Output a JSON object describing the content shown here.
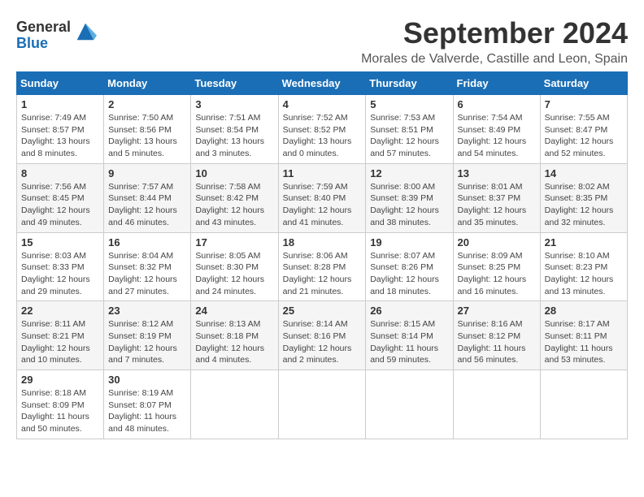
{
  "logo": {
    "general": "General",
    "blue": "Blue"
  },
  "title": "September 2024",
  "location": "Morales de Valverde, Castille and Leon, Spain",
  "days_of_week": [
    "Sunday",
    "Monday",
    "Tuesday",
    "Wednesday",
    "Thursday",
    "Friday",
    "Saturday"
  ],
  "weeks": [
    [
      {
        "day": "1",
        "sunrise": "7:49 AM",
        "sunset": "8:57 PM",
        "daylight": "13 hours and 8 minutes."
      },
      {
        "day": "2",
        "sunrise": "7:50 AM",
        "sunset": "8:56 PM",
        "daylight": "13 hours and 5 minutes."
      },
      {
        "day": "3",
        "sunrise": "7:51 AM",
        "sunset": "8:54 PM",
        "daylight": "13 hours and 3 minutes."
      },
      {
        "day": "4",
        "sunrise": "7:52 AM",
        "sunset": "8:52 PM",
        "daylight": "13 hours and 0 minutes."
      },
      {
        "day": "5",
        "sunrise": "7:53 AM",
        "sunset": "8:51 PM",
        "daylight": "12 hours and 57 minutes."
      },
      {
        "day": "6",
        "sunrise": "7:54 AM",
        "sunset": "8:49 PM",
        "daylight": "12 hours and 54 minutes."
      },
      {
        "day": "7",
        "sunrise": "7:55 AM",
        "sunset": "8:47 PM",
        "daylight": "12 hours and 52 minutes."
      }
    ],
    [
      {
        "day": "8",
        "sunrise": "7:56 AM",
        "sunset": "8:45 PM",
        "daylight": "12 hours and 49 minutes."
      },
      {
        "day": "9",
        "sunrise": "7:57 AM",
        "sunset": "8:44 PM",
        "daylight": "12 hours and 46 minutes."
      },
      {
        "day": "10",
        "sunrise": "7:58 AM",
        "sunset": "8:42 PM",
        "daylight": "12 hours and 43 minutes."
      },
      {
        "day": "11",
        "sunrise": "7:59 AM",
        "sunset": "8:40 PM",
        "daylight": "12 hours and 41 minutes."
      },
      {
        "day": "12",
        "sunrise": "8:00 AM",
        "sunset": "8:39 PM",
        "daylight": "12 hours and 38 minutes."
      },
      {
        "day": "13",
        "sunrise": "8:01 AM",
        "sunset": "8:37 PM",
        "daylight": "12 hours and 35 minutes."
      },
      {
        "day": "14",
        "sunrise": "8:02 AM",
        "sunset": "8:35 PM",
        "daylight": "12 hours and 32 minutes."
      }
    ],
    [
      {
        "day": "15",
        "sunrise": "8:03 AM",
        "sunset": "8:33 PM",
        "daylight": "12 hours and 29 minutes."
      },
      {
        "day": "16",
        "sunrise": "8:04 AM",
        "sunset": "8:32 PM",
        "daylight": "12 hours and 27 minutes."
      },
      {
        "day": "17",
        "sunrise": "8:05 AM",
        "sunset": "8:30 PM",
        "daylight": "12 hours and 24 minutes."
      },
      {
        "day": "18",
        "sunrise": "8:06 AM",
        "sunset": "8:28 PM",
        "daylight": "12 hours and 21 minutes."
      },
      {
        "day": "19",
        "sunrise": "8:07 AM",
        "sunset": "8:26 PM",
        "daylight": "12 hours and 18 minutes."
      },
      {
        "day": "20",
        "sunrise": "8:09 AM",
        "sunset": "8:25 PM",
        "daylight": "12 hours and 16 minutes."
      },
      {
        "day": "21",
        "sunrise": "8:10 AM",
        "sunset": "8:23 PM",
        "daylight": "12 hours and 13 minutes."
      }
    ],
    [
      {
        "day": "22",
        "sunrise": "8:11 AM",
        "sunset": "8:21 PM",
        "daylight": "12 hours and 10 minutes."
      },
      {
        "day": "23",
        "sunrise": "8:12 AM",
        "sunset": "8:19 PM",
        "daylight": "12 hours and 7 minutes."
      },
      {
        "day": "24",
        "sunrise": "8:13 AM",
        "sunset": "8:18 PM",
        "daylight": "12 hours and 4 minutes."
      },
      {
        "day": "25",
        "sunrise": "8:14 AM",
        "sunset": "8:16 PM",
        "daylight": "12 hours and 2 minutes."
      },
      {
        "day": "26",
        "sunrise": "8:15 AM",
        "sunset": "8:14 PM",
        "daylight": "11 hours and 59 minutes."
      },
      {
        "day": "27",
        "sunrise": "8:16 AM",
        "sunset": "8:12 PM",
        "daylight": "11 hours and 56 minutes."
      },
      {
        "day": "28",
        "sunrise": "8:17 AM",
        "sunset": "8:11 PM",
        "daylight": "11 hours and 53 minutes."
      }
    ],
    [
      {
        "day": "29",
        "sunrise": "8:18 AM",
        "sunset": "8:09 PM",
        "daylight": "11 hours and 50 minutes."
      },
      {
        "day": "30",
        "sunrise": "8:19 AM",
        "sunset": "8:07 PM",
        "daylight": "11 hours and 48 minutes."
      },
      null,
      null,
      null,
      null,
      null
    ]
  ],
  "labels": {
    "sunrise": "Sunrise:",
    "sunset": "Sunset:",
    "daylight": "Daylight:"
  }
}
